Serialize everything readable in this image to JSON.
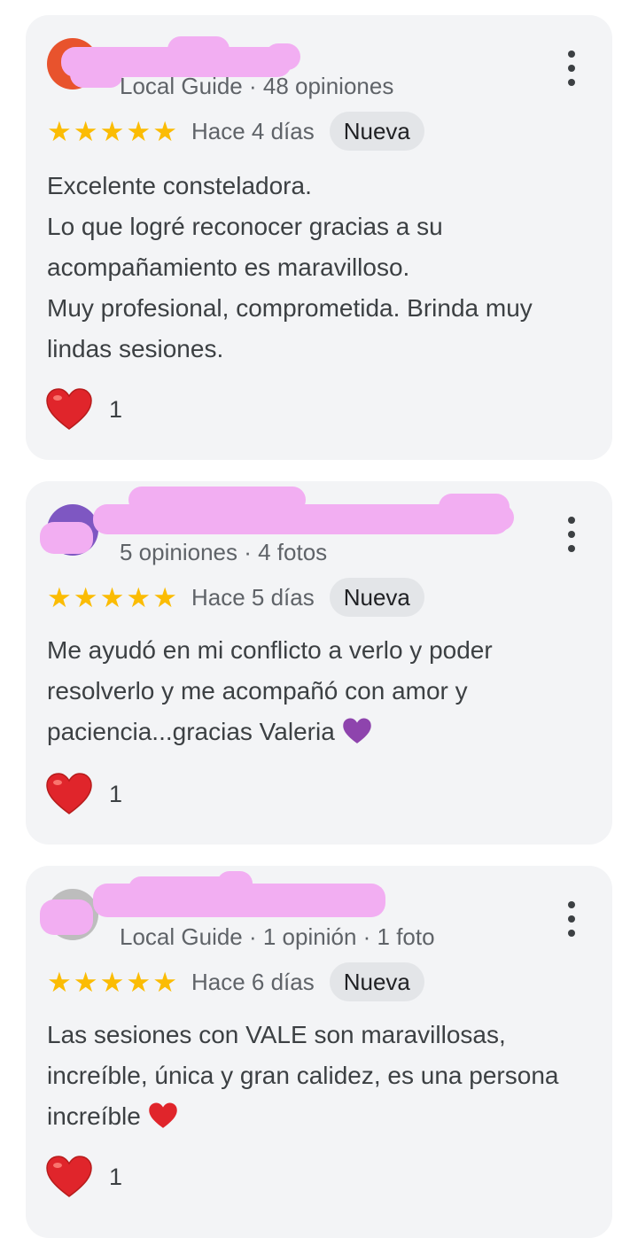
{
  "reviews": [
    {
      "reviewer_meta": "Local Guide · 48 opiniones",
      "time": "Hace 4 días",
      "badge": "Nueva",
      "text_lines": [
        "Excelente consteladora.",
        "Lo que logré reconocer gracias a su acompañamiento es maravilloso.",
        "Muy profesional, comprometida. Brinda muy lindas sesiones."
      ],
      "likes": "1",
      "avatar_color": "#e8532d"
    },
    {
      "reviewer_meta": "5 opiniones · 4 fotos",
      "time": "Hace 5 días",
      "badge": "Nueva",
      "text_lines": [
        "Me ayudó en mi conflicto a verlo y poder resolverlo y me acompañó con amor y paciencia...gracias Valeria"
      ],
      "likes": "1",
      "avatar_color": "#7e57c2"
    },
    {
      "reviewer_meta": "Local Guide · 1 opinión · 1 foto",
      "time": "Hace 6 días",
      "badge": "Nueva",
      "text_lines": [
        "Las sesiones con VALE son maravillosas, increíble, única y gran calidez, es una persona increíble"
      ],
      "likes": "1",
      "avatar_color": "#bdbdbd"
    }
  ],
  "icons": {
    "star": "star-icon",
    "like": "heart-icon",
    "menu": "more-vert-icon",
    "emoji_review2": "purple-heart-emoji",
    "emoji_review3": "red-heart-emoji"
  },
  "colors": {
    "star": "#fbbc04",
    "heart_red": "#e0252b",
    "heart_purple": "#8e44ad",
    "card_bg": "#f3f4f6",
    "badge_bg": "#e3e5e8",
    "redaction": "#f2aef2"
  }
}
